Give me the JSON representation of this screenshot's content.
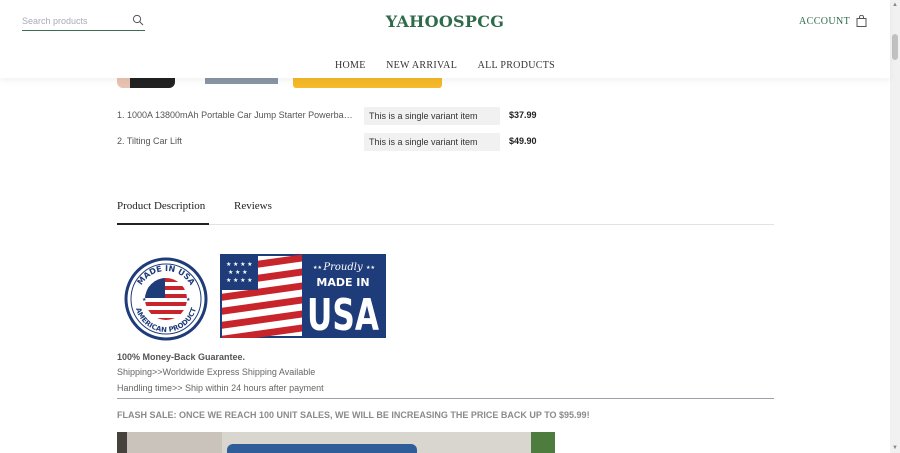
{
  "header": {
    "search_placeholder": "Search products",
    "logo": "YAHOOSPCG",
    "account_label": "ACCOUNT",
    "nav": [
      "HOME",
      "NEW ARRIVAL",
      "ALL PRODUCTS"
    ]
  },
  "bundle_items": [
    {
      "name": "1. 1000A 13800mAh Portable Car Jump Starter Powerbank ...",
      "variant": "This is a single variant item",
      "price": "$37.99"
    },
    {
      "name": "2. Tilting Car Lift",
      "variant": "This is a single variant item",
      "price": "$49.90"
    }
  ],
  "tabs": {
    "description": "Product Description",
    "reviews": "Reviews"
  },
  "badges": {
    "round_top": "MADE IN USA",
    "round_bottom": "AMERICAN PRODUCT",
    "flag_script": "Proudly",
    "flag_made": "MADE IN",
    "flag_usa": "USA"
  },
  "description": {
    "guarantee": "100% Money-Back Guarantee.",
    "shipping": "Shipping>>Worldwide Express Shipping Available",
    "handling": "Handling time>> Ship within 24 hours after payment",
    "flash_sale": "FLASH SALE: ONCE WE REACH 100 UNIT SALES, WE WILL BE INCREASING THE PRICE BACK UP TO $95.99!"
  },
  "colors": {
    "brand_green": "#2f6b4a",
    "button_yellow": "#f6b92a",
    "flag_blue": "#1f3c7a",
    "flag_red": "#c8242c"
  }
}
